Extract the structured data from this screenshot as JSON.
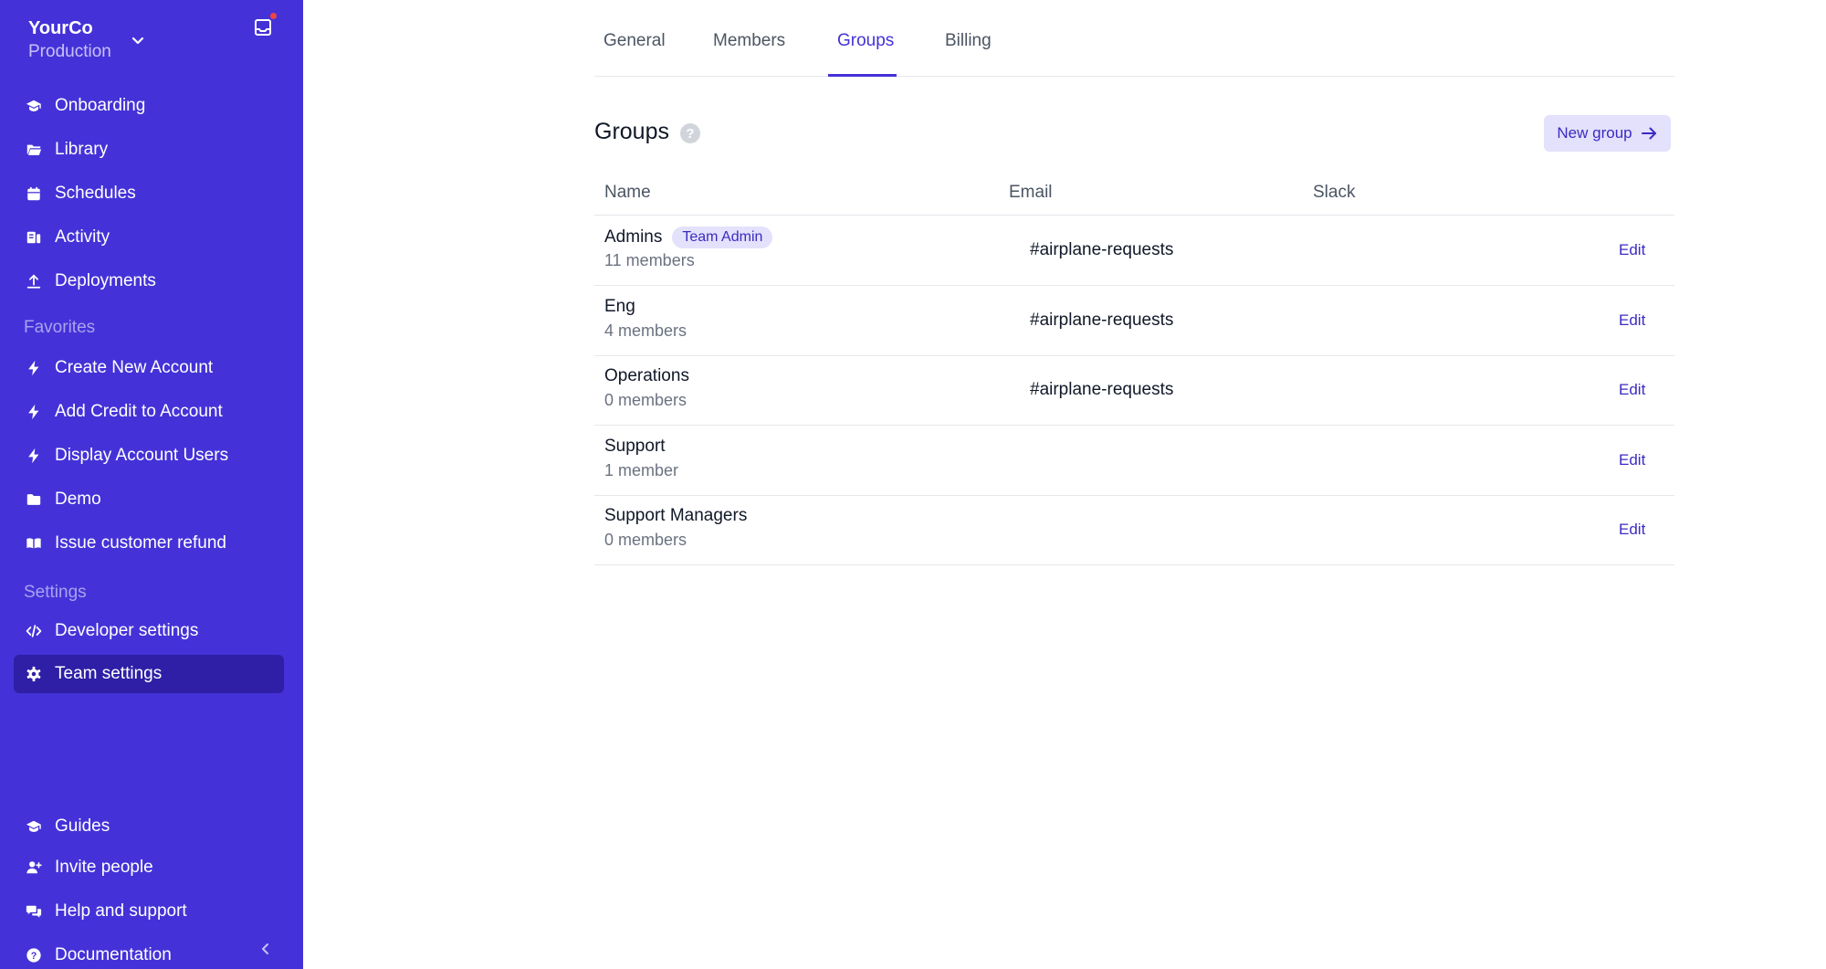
{
  "org": {
    "name": "YourCo",
    "environment": "Production"
  },
  "sidebar": {
    "main_items": [
      {
        "label": "Onboarding",
        "icon": "graduation-cap-icon"
      },
      {
        "label": "Library",
        "icon": "folder-open-icon"
      },
      {
        "label": "Schedules",
        "icon": "calendar-icon"
      },
      {
        "label": "Activity",
        "icon": "activity-icon"
      },
      {
        "label": "Deployments",
        "icon": "upload-icon"
      }
    ],
    "favorites_title": "Favorites",
    "favorites": [
      {
        "label": "Create New Account",
        "icon": "bolt-icon"
      },
      {
        "label": "Add Credit to Account",
        "icon": "bolt-icon"
      },
      {
        "label": "Display Account Users",
        "icon": "bolt-icon"
      },
      {
        "label": "Demo",
        "icon": "folder-icon"
      },
      {
        "label": "Issue customer refund",
        "icon": "book-open-icon"
      }
    ],
    "settings_title": "Settings",
    "settings": [
      {
        "label": "Developer settings",
        "icon": "code-icon"
      },
      {
        "label": "Team settings",
        "icon": "gear-icon",
        "active": true
      }
    ],
    "footer": [
      {
        "label": "Guides",
        "icon": "graduation-cap-icon"
      },
      {
        "label": "Invite people",
        "icon": "user-plus-icon"
      },
      {
        "label": "Help and support",
        "icon": "chat-icon"
      },
      {
        "label": "Documentation",
        "icon": "question-circle-icon"
      }
    ]
  },
  "tabs": [
    {
      "label": "General"
    },
    {
      "label": "Members"
    },
    {
      "label": "Groups",
      "active": true
    },
    {
      "label": "Billing"
    }
  ],
  "groups": {
    "title": "Groups",
    "help_glyph": "?",
    "new_button": "New group",
    "columns": {
      "name": "Name",
      "email": "Email",
      "slack": "Slack"
    },
    "rows": [
      {
        "name": "Admins",
        "badge": "Team Admin",
        "count": "11 members",
        "email": "",
        "slack": "#airplane-requests",
        "action": "Edit"
      },
      {
        "name": "Eng",
        "badge": "",
        "count": "4 members",
        "email": "",
        "slack": "#airplane-requests",
        "action": "Edit"
      },
      {
        "name": "Operations",
        "badge": "",
        "count": "0 members",
        "email": "",
        "slack": "#airplane-requests",
        "action": "Edit"
      },
      {
        "name": "Support",
        "badge": "",
        "count": "1 member",
        "email": "",
        "slack": "",
        "action": "Edit"
      },
      {
        "name": "Support Managers",
        "badge": "",
        "count": "0 members",
        "email": "",
        "slack": "",
        "action": "Edit"
      }
    ]
  },
  "colors": {
    "sidebar_bg": "#4432d8",
    "accent": "#3b2bc2",
    "active_nav": "#2e1fa6",
    "notification_dot": "#ef4444"
  }
}
